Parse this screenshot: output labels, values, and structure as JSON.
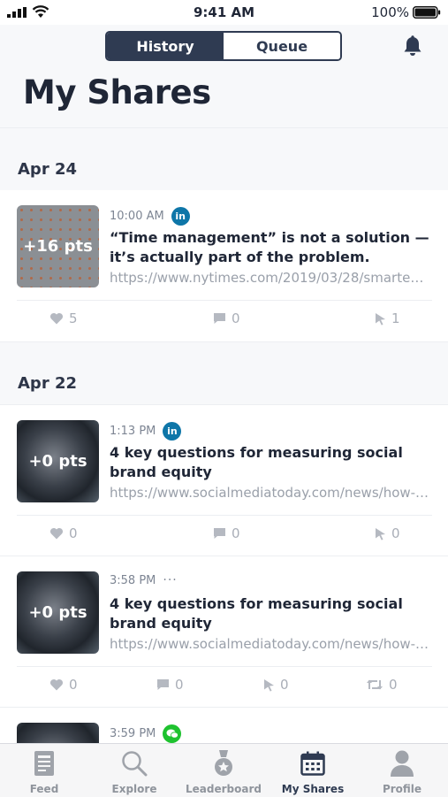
{
  "status": {
    "time": "9:41 AM",
    "battery": "100%"
  },
  "header": {
    "tabs": [
      "History",
      "Queue"
    ],
    "title": "My Shares"
  },
  "sections": [
    {
      "date": "Apr 24"
    },
    {
      "date": "Apr 22"
    }
  ],
  "posts": [
    {
      "time": "10:00 AM",
      "network": "in",
      "points": "+16 pts",
      "title": "“Time management” is not a solution — it’s actually part of the problem.",
      "url": "https://www.nytimes.com/2019/03/28/smarte…",
      "likes": "5",
      "comments": "0",
      "clicks": "1"
    },
    {
      "time": "1:13 PM",
      "network": "in",
      "points": "+0 pts",
      "title": "4 key questions for measuring social brand equity",
      "url": "https://www.socialmediatoday.com/news/how-…",
      "likes": "0",
      "comments": "0",
      "clicks": "0"
    },
    {
      "time": "3:58 PM",
      "network": "···",
      "points": "+0 pts",
      "title": "4 key questions for measuring social brand equity",
      "url": "https://www.socialmediatoday.com/news/how-…",
      "likes": "0",
      "comments": "0",
      "clicks": "0",
      "reshares": "0"
    },
    {
      "time": "3:59 PM",
      "network": "wechat"
    }
  ],
  "icons": {
    "like": "heart-icon",
    "comment": "comment-icon",
    "click": "cursor-icon",
    "reshare": "retweet-icon"
  },
  "tabbar": [
    {
      "label": "Feed",
      "icon": "feed-icon"
    },
    {
      "label": "Explore",
      "icon": "search-icon"
    },
    {
      "label": "Leaderboard",
      "icon": "medal-icon"
    },
    {
      "label": "My Shares",
      "icon": "calendar-icon",
      "active": true
    },
    {
      "label": "Profile",
      "icon": "person-icon"
    }
  ],
  "colors": {
    "accent": "#2f3b52",
    "linkedin": "#0e76a8",
    "wechat": "#1ec22f",
    "muted": "#a9aeb7"
  }
}
